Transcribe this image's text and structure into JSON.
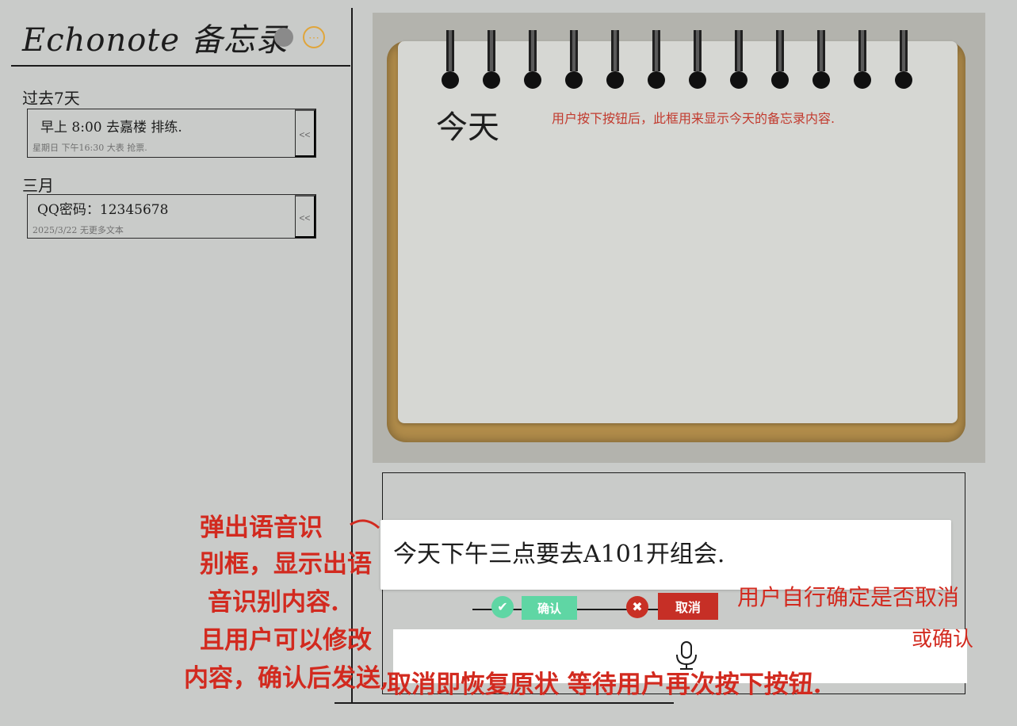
{
  "app": {
    "title": "Echonote 备忘录",
    "more_icon": "⋯"
  },
  "memo_groups": [
    {
      "label": "过去7天",
      "items": [
        {
          "title": "早上 8:00  去嘉楼  排练.",
          "subtitle": "星期日   下午16:30  大表  抢票.",
          "collapse_label": "<<"
        }
      ]
    },
    {
      "label": "三月",
      "items": [
        {
          "title": "QQ密码：12345678",
          "subtitle": "2025/3/22   无更多文本",
          "collapse_label": "<<"
        }
      ]
    }
  ],
  "notebook": {
    "heading": "今天",
    "annotation": "用户按下按钮后，此框用来显示今天的备忘录内容."
  },
  "voice_popup": {
    "recognized_text": "今天下午三点要去A101开组会."
  },
  "actions": {
    "confirm_label": "确认",
    "cancel_label": "取消"
  },
  "annotations": {
    "left_lines": [
      "弹出语音识",
      "别框，显示出语",
      "音识别内容.",
      "且用户可以修改",
      "内容，确认后发送,"
    ],
    "bottom": "取消即恢复原状 等待用户再次按下按钮.",
    "right_line1": "用户自行确定是否取消",
    "right_line2": "或确认"
  },
  "colors": {
    "background": "#c9cbc9",
    "confirm": "#5fd6a4",
    "cancel": "#c62f26",
    "annotation_red": "#d22a1f",
    "notebook_cover": "#b18c4a"
  }
}
